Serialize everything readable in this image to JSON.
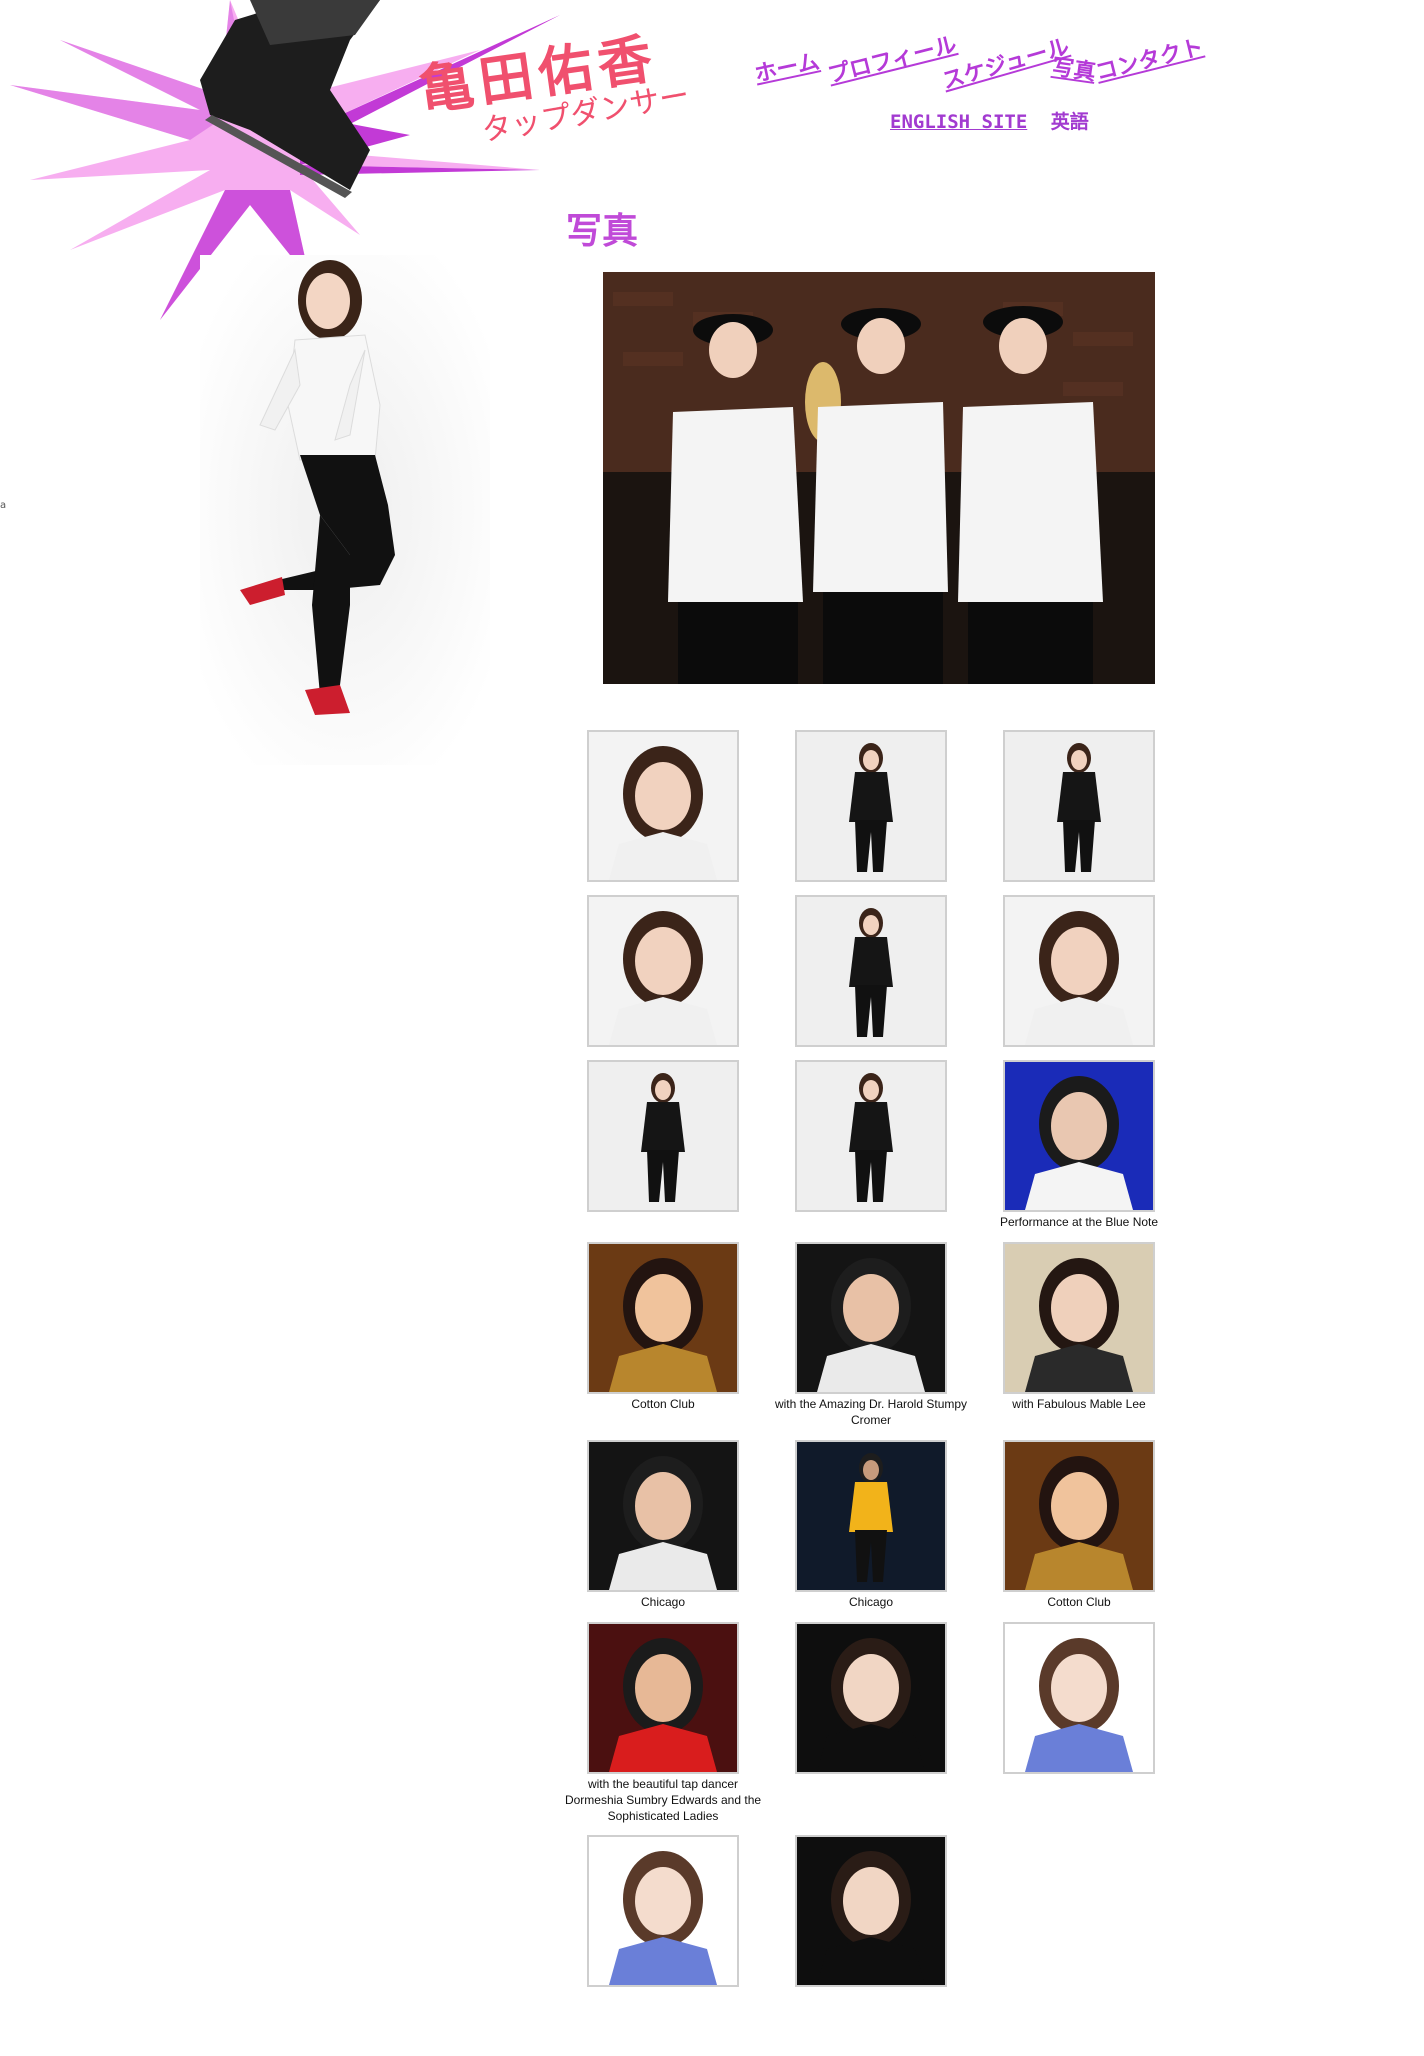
{
  "site": {
    "name": "亀田佑香",
    "tagline": "タップダンサー"
  },
  "nav": {
    "items": [
      {
        "label": "ホーム",
        "icon": "none"
      },
      {
        "label": "プロフィール",
        "icon": "none"
      },
      {
        "label": "スケジュール",
        "icon": "none"
      },
      {
        "label": "写真",
        "icon": "none"
      },
      {
        "label": "コンタクト",
        "icon": "none"
      }
    ],
    "english_link": "ENGLISH SITE",
    "english_label": "英語"
  },
  "edge_mark": "a",
  "page": {
    "title": "写真"
  },
  "colors": {
    "accent": "#b53ad8",
    "burst_light": "#f7aef0",
    "burst_dark": "#c23ad6",
    "logo": "#f0506e"
  },
  "gallery": {
    "rows": [
      [
        {
          "caption": "",
          "scene": "portrait-light"
        },
        {
          "caption": "",
          "scene": "full-body-light"
        },
        {
          "caption": "",
          "scene": "full-body-light"
        }
      ],
      [
        {
          "caption": "",
          "scene": "portrait-light"
        },
        {
          "caption": "",
          "scene": "full-body-light"
        },
        {
          "caption": "",
          "scene": "portrait-light"
        }
      ],
      [
        {
          "caption": "",
          "scene": "full-body-light"
        },
        {
          "caption": "",
          "scene": "full-body-light"
        },
        {
          "caption": "Performance at the Blue Note",
          "scene": "stage-blue"
        }
      ],
      [
        {
          "caption": "Cotton Club",
          "scene": "warm-portrait"
        },
        {
          "caption": "with the Amazing Dr. Harold Stumpy Cromer",
          "scene": "dark-group"
        },
        {
          "caption": "with Fabulous Mable Lee",
          "scene": "indoor-group"
        }
      ],
      [
        {
          "caption": "Chicago",
          "scene": "dark-group"
        },
        {
          "caption": "Chicago",
          "scene": "stage-dark"
        },
        {
          "caption": "Cotton Club",
          "scene": "warm-portrait"
        }
      ],
      [
        {
          "caption": "with the beautiful tap dancer Dormeshia Sumbry Edwards and the Sophisticated Ladies",
          "scene": "red-group"
        },
        {
          "caption": "",
          "scene": "close-portrait"
        },
        {
          "caption": "",
          "scene": "close-portrait-light"
        }
      ],
      [
        {
          "caption": "",
          "scene": "close-portrait-light"
        },
        {
          "caption": "",
          "scene": "close-portrait"
        }
      ]
    ]
  }
}
